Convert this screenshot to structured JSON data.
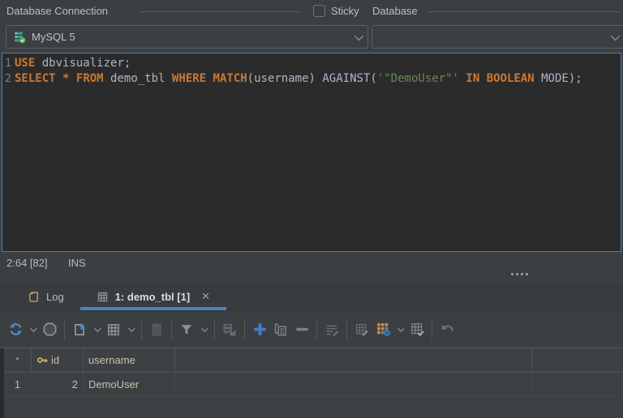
{
  "connection_form": {
    "db_connection_label": "Database Connection",
    "sticky_label": "Sticky",
    "database_label": "Database",
    "connection_value": "MySQL 5",
    "database_value": ""
  },
  "editor": {
    "lines": [
      {
        "num": "1",
        "tokens": [
          {
            "text": "USE",
            "type": "keyword"
          },
          {
            "text": " dbvisualizer;",
            "type": "plain"
          }
        ]
      },
      {
        "num": "2",
        "tokens": [
          {
            "text": "SELECT",
            "type": "keyword"
          },
          {
            "text": " ",
            "type": "plain"
          },
          {
            "text": "*",
            "type": "keyword"
          },
          {
            "text": " ",
            "type": "plain"
          },
          {
            "text": "FROM",
            "type": "keyword"
          },
          {
            "text": " demo_tbl ",
            "type": "plain"
          },
          {
            "text": "WHERE",
            "type": "keyword"
          },
          {
            "text": " ",
            "type": "plain"
          },
          {
            "text": "MATCH",
            "type": "keyword"
          },
          {
            "text": "(username) AGAINST(",
            "type": "plain"
          },
          {
            "text": "'\"DemoUser\"'",
            "type": "string"
          },
          {
            "text": " ",
            "type": "plain"
          },
          {
            "text": "IN BOOLEAN",
            "type": "keyword"
          },
          {
            "text": " MODE);",
            "type": "plain"
          }
        ]
      }
    ]
  },
  "status_bar": {
    "position": "2:64 [82]",
    "mode": "INS"
  },
  "tabs": [
    {
      "label": "Log",
      "active": false
    },
    {
      "label": "1: demo_tbl [1]",
      "active": true
    }
  ],
  "icons": {
    "close": "✕"
  },
  "toolbar": {
    "items": [
      {
        "type": "icon",
        "icon": "refresh",
        "name": "rerun-query-button"
      },
      {
        "type": "chevron",
        "name": "rerun-options-chevron"
      },
      {
        "type": "icon",
        "icon": "stop",
        "name": "stop-execution-button"
      },
      {
        "type": "separator"
      },
      {
        "type": "icon",
        "icon": "export",
        "name": "export-grid-button"
      },
      {
        "type": "chevron",
        "name": "export-options-chevron"
      },
      {
        "type": "icon",
        "icon": "grid",
        "name": "grid-view-button"
      },
      {
        "type": "chevron",
        "name": "grid-view-options-chevron"
      },
      {
        "type": "separator"
      },
      {
        "type": "icon",
        "icon": "calculator",
        "name": "calculate-button"
      },
      {
        "type": "separator"
      },
      {
        "type": "icon",
        "icon": "filter",
        "name": "filter-button"
      },
      {
        "type": "chevron",
        "name": "filter-options-chevron"
      },
      {
        "type": "separator"
      },
      {
        "type": "icon",
        "icon": "savedb",
        "name": "save-table-data-button"
      },
      {
        "type": "separator"
      },
      {
        "type": "icon",
        "icon": "plus",
        "name": "insert-row-button"
      },
      {
        "type": "icon",
        "icon": "copy",
        "name": "duplicate-row-button"
      },
      {
        "type": "icon",
        "icon": "minus",
        "name": "delete-row-button"
      },
      {
        "type": "separator"
      },
      {
        "type": "icon",
        "icon": "editrows",
        "name": "edit-rows-button"
      },
      {
        "type": "separator"
      },
      {
        "type": "icon",
        "icon": "gridpencil",
        "name": "edit-table-data-button"
      },
      {
        "type": "icon",
        "icon": "gridgear",
        "name": "table-data-settings-button"
      },
      {
        "type": "chevron",
        "name": "table-data-settings-chevron"
      },
      {
        "type": "icon",
        "icon": "gridcheck",
        "name": "apply-edits-button"
      },
      {
        "type": "separator"
      },
      {
        "type": "icon",
        "icon": "undo",
        "name": "undo-button"
      }
    ]
  },
  "table": {
    "columns": [
      "*",
      "id",
      "username",
      "",
      ""
    ],
    "rows": [
      {
        "row_num": "1",
        "id": "2",
        "username": "DemoUser"
      }
    ]
  }
}
